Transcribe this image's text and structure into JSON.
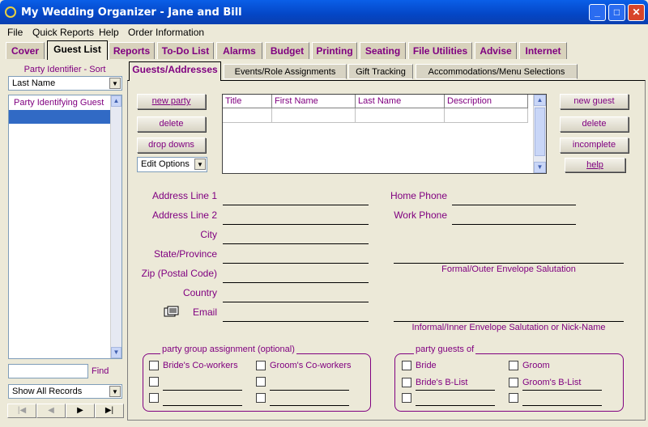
{
  "window": {
    "title": "My Wedding Organizer - Jane and Bill",
    "min": "_",
    "max": "□",
    "close": "✕"
  },
  "menu": [
    "File",
    "Quick Reports",
    "Help",
    "Order Information"
  ],
  "tabs": [
    "Cover",
    "Guest List",
    "Reports",
    "To-Do List",
    "Alarms",
    "Budget",
    "Printing",
    "Seating",
    "File Utilities",
    "Advise",
    "Internet"
  ],
  "left": {
    "sort_label": "Party Identifier - Sort",
    "sort_value": "Last Name",
    "list_header": "Party Identifying Guest",
    "find_value": "",
    "find_label": "Find",
    "filter_value": "Show All Records",
    "nav": [
      "|◀",
      "◀",
      "▶",
      "▶|"
    ]
  },
  "subtabs": [
    "Guests/Addresses",
    "Events/Role Assignments",
    "Gift Tracking",
    "Accommodations/Menu Selections"
  ],
  "party_buttons": {
    "new_party": "new party",
    "delete": "delete",
    "drop_downs": "drop downs",
    "edit_options": "Edit Options"
  },
  "guest_buttons": {
    "new_guest": "new guest",
    "delete": "delete",
    "incomplete": "incomplete",
    "help": "help"
  },
  "grid": {
    "columns": [
      "Title",
      "First Name",
      "Last Name",
      "Description"
    ]
  },
  "address": {
    "line1": "Address Line 1",
    "line2": "Address Line 2",
    "city": "City",
    "state": "State/Province",
    "zip": "Zip (Postal Code)",
    "country": "Country",
    "email": "Email",
    "home_phone": "Home Phone",
    "work_phone": "Work Phone",
    "formal_salutation": "Formal/Outer Envelope Salutation",
    "informal_salutation": "Informal/Inner Envelope Salutation or Nick-Name"
  },
  "party_group": {
    "title": "party group assignment (optional)",
    "items": [
      "Bride's Co-workers",
      "Groom's Co-workers"
    ]
  },
  "party_guests": {
    "title": "party guests of",
    "items": [
      "Bride",
      "Groom",
      "Bride's B-List",
      "Groom's B-List"
    ]
  }
}
